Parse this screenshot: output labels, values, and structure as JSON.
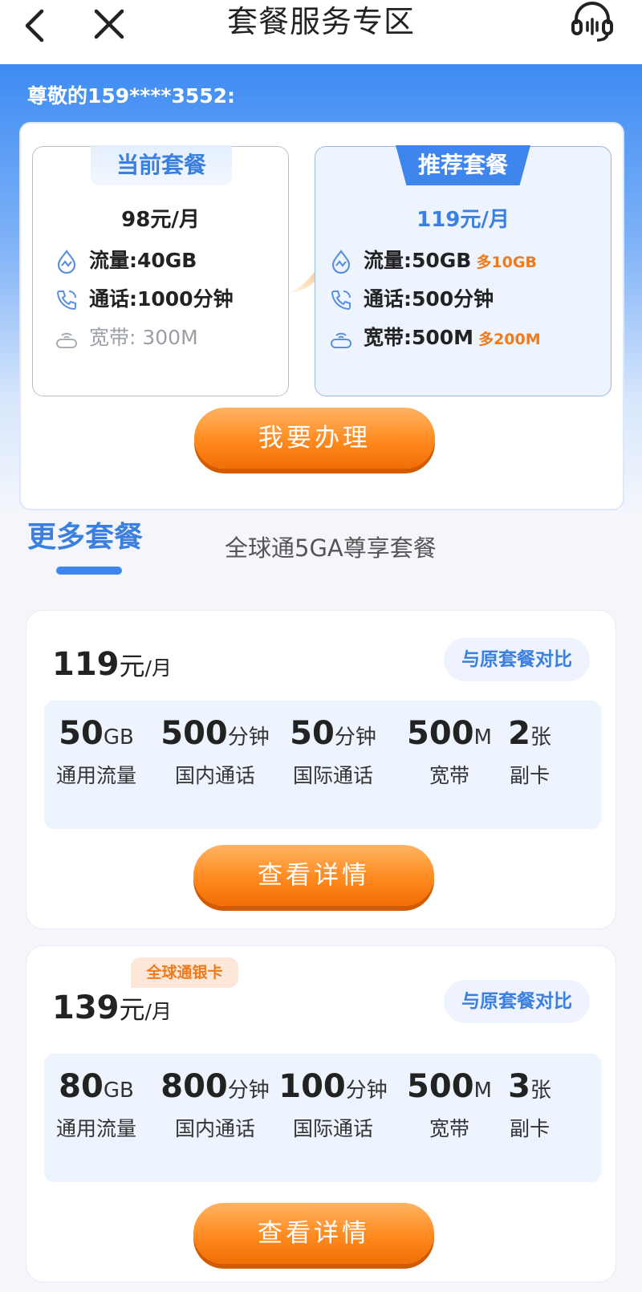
{
  "nav": {
    "title": "套餐服务专区",
    "icons": [
      "back-arrow-icon",
      "close-icon",
      "customer-service-icon"
    ]
  },
  "greeting": "尊敬的159****3552:",
  "compare": {
    "current": {
      "tag": "当前套餐",
      "price": "98元/月",
      "rows": [
        {
          "icon": "data-flow-icon",
          "text": "流量:40GB",
          "extra": ""
        },
        {
          "icon": "phone-call-icon",
          "text": "通话:1000分钟",
          "extra": ""
        },
        {
          "icon": "broadband-router-icon",
          "text": "宽带: 300M",
          "extra": ""
        }
      ]
    },
    "recommend": {
      "tag": "推荐套餐",
      "price": "119元/月",
      "rows": [
        {
          "icon": "data-flow-icon",
          "text": "流量:50GB",
          "extra": "多10GB"
        },
        {
          "icon": "phone-call-icon",
          "text": "通话:500分钟",
          "extra": ""
        },
        {
          "icon": "broadband-router-icon",
          "text": "宽带:500M",
          "extra": "多200M"
        }
      ]
    },
    "button": "我要办理",
    "colors": {
      "blue": "#3b7fe0",
      "orange": "#f07a1c"
    }
  },
  "tabs": {
    "active": "更多套餐",
    "other": "全球通5GA尊享套餐"
  },
  "packages": [
    {
      "price": "119",
      "unit": "元",
      "per": "/月",
      "badge": "",
      "compare": "与原套餐对比",
      "features": [
        {
          "value": "50",
          "unit": "GB",
          "label": "通用流量"
        },
        {
          "value": "500",
          "unit": "分钟",
          "label": "国内通话"
        },
        {
          "value": "50",
          "unit": "分钟",
          "label": "国际通话"
        },
        {
          "value": "500",
          "unit": "M",
          "label": "宽带"
        },
        {
          "value": "2",
          "unit": "张",
          "label": "副卡"
        }
      ],
      "button": "查看详情"
    },
    {
      "price": "139",
      "unit": "元",
      "per": "/月",
      "badge": "全球通银卡",
      "compare": "与原套餐对比",
      "features": [
        {
          "value": "80",
          "unit": "GB",
          "label": "通用流量"
        },
        {
          "value": "800",
          "unit": "分钟",
          "label": "国内通话"
        },
        {
          "value": "100",
          "unit": "分钟",
          "label": "国际通话"
        },
        {
          "value": "500",
          "unit": "M",
          "label": "宽带"
        },
        {
          "value": "3",
          "unit": "张",
          "label": "副卡"
        }
      ],
      "button": "查看详情"
    }
  ]
}
